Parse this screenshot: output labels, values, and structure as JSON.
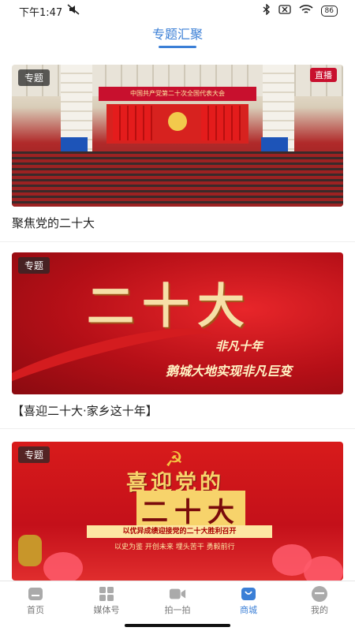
{
  "status_bar": {
    "time": "下午1:47",
    "battery": "86",
    "icons": [
      "mute-icon",
      "bluetooth-icon",
      "sim-off-icon",
      "wifi-icon",
      "battery-icon"
    ]
  },
  "header": {
    "title": "专题汇聚"
  },
  "feed": [
    {
      "badge": "专题",
      "live_badge": "直播",
      "banner_text": "中国共产党第二十次全国代表大会",
      "caption": "聚焦党的二十大"
    },
    {
      "badge": "专题",
      "big_text": "二十大",
      "line1": "非凡十年",
      "line2": "鹅城大地实现非凡巨变",
      "caption": "【喜迎二十大·家乡这十年】"
    },
    {
      "badge": "专题",
      "title_line1": "喜迎党的",
      "title_line2": "二十大",
      "stripe_text": "以优异成绩迎接党的二十大胜利召开",
      "slogan": "以史为鉴  开创未来  埋头苦干  勇毅前行"
    }
  ],
  "tabbar": {
    "items": [
      {
        "label": "首页",
        "icon": "home-icon"
      },
      {
        "label": "媒体号",
        "icon": "grid-icon"
      },
      {
        "label": "拍一拍",
        "icon": "video-icon"
      },
      {
        "label": "商城",
        "icon": "shop-icon"
      },
      {
        "label": "我的",
        "icon": "profile-icon"
      }
    ],
    "active_index": 3,
    "active_color": "#3b7fd6"
  }
}
